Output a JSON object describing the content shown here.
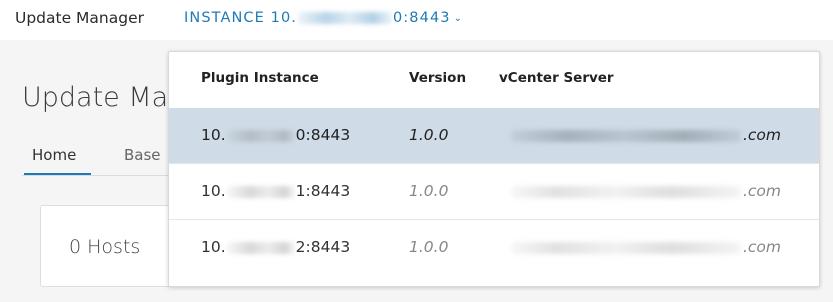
{
  "header": {
    "app_title": "Update Manager",
    "instance": {
      "prefix": "INSTANCE 10.",
      "suffix": "0:8443",
      "chevron": "⌄"
    }
  },
  "page": {
    "heading": "Update Ma",
    "tabs": [
      {
        "label": "Home",
        "active": true
      },
      {
        "label": "Base",
        "active": false
      }
    ],
    "hosts_card": {
      "label": "0 Hosts"
    }
  },
  "dropdown": {
    "columns": [
      "Plugin Instance",
      "Version",
      "vCenter Server"
    ],
    "rows": [
      {
        "ip_prefix": "10.",
        "ip_suffix": "0:8443",
        "version": "1.0.0",
        "vc_suffix": ".com",
        "selected": true
      },
      {
        "ip_prefix": "10.",
        "ip_suffix": "1:8443",
        "version": "1.0.0",
        "vc_suffix": ".com",
        "selected": false
      },
      {
        "ip_prefix": "10.",
        "ip_suffix": "2:8443",
        "version": "1.0.0",
        "vc_suffix": ".com",
        "selected": false
      }
    ]
  },
  "colors": {
    "accent": "#1f7ab8",
    "selected_row": "#cfdbe6"
  }
}
